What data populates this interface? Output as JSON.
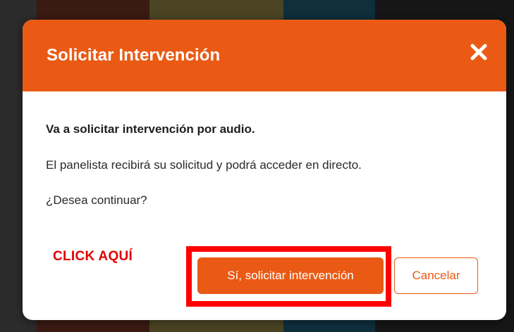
{
  "modal": {
    "title": "Solicitar Intervención",
    "close_icon": "close-icon",
    "lead": "Va a solicitar intervención por audio.",
    "description": "El panelista recibirá su solicitud y podrá acceder en directo.",
    "question": "¿Desea continuar?",
    "confirm_label": "Sí, solicitar intervención",
    "cancel_label": "Cancelar"
  },
  "annotation": {
    "callout_text": "CLICK AQUÍ",
    "callout_color": "#e00000",
    "highlight_color": "#ff0000"
  },
  "colors": {
    "accent": "#ea5a15",
    "backdrop": "#1c1c1c"
  }
}
